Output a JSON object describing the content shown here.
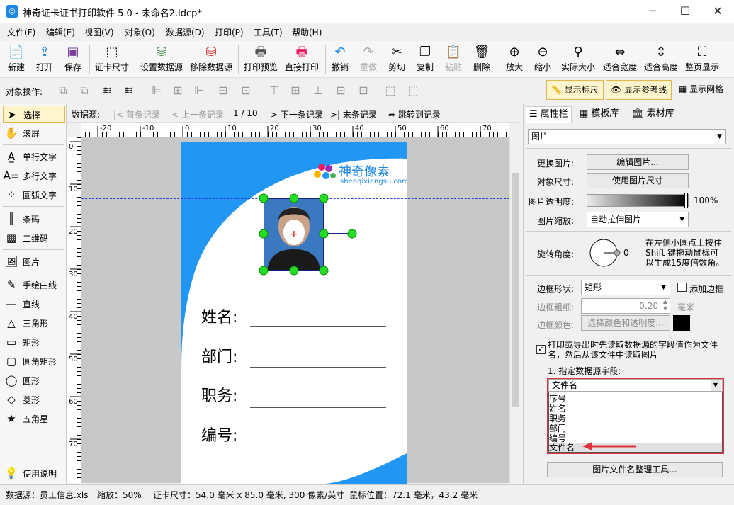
{
  "window": {
    "title": "神奇证卡证书打印软件 5.0 - 未命名2.idcp*",
    "min": "─",
    "max": "☐",
    "close": "✕"
  },
  "menu": [
    "文件(F)",
    "编辑(E)",
    "视图(V)",
    "对象(O)",
    "数据源(D)",
    "打印(P)",
    "工具(T)",
    "帮助(H)"
  ],
  "toolbar": [
    "新建",
    "打开",
    "保存",
    "证卡尺寸",
    "设置数据源",
    "移除数据源",
    "打印预览",
    "直接打印",
    "撤销",
    "重做",
    "剪切",
    "复制",
    "粘贴",
    "删除",
    "放大",
    "缩小",
    "实际大小",
    "适合宽度",
    "适合高度",
    "整页显示"
  ],
  "objbar": {
    "label": "对象操作:",
    "show_ruler": "显示标尺",
    "show_guides": "显示参考线",
    "show_grid": "显示网格"
  },
  "tools": [
    "选择",
    "滚屏",
    "单行文字",
    "多行文字",
    "圆弧文字",
    "条码",
    "二维码",
    "图片",
    "手绘曲线",
    "直线",
    "三角形",
    "矩形",
    "圆角矩形",
    "圆形",
    "菱形",
    "五角星",
    "使用说明"
  ],
  "nav": {
    "label": "数据源:",
    "first": "首条记录",
    "prev": "上一条记录",
    "pos": "1 / 10",
    "next": "下一条记录",
    "last": "末条记录",
    "jump": "跳转到记录"
  },
  "ruler": {
    "h_ticks": [
      "-20",
      "-10",
      "0",
      "10",
      "20",
      "30",
      "40",
      "50",
      "60",
      "70"
    ],
    "v_ticks": [
      "0",
      "10",
      "20",
      "30",
      "40",
      "50",
      "60",
      "70"
    ]
  },
  "card": {
    "brand_cn": "神奇像素",
    "brand_en": "shenqixiangsu.com",
    "fields": [
      "姓名:",
      "部门:",
      "职务:",
      "编号:"
    ]
  },
  "panel": {
    "tabs": [
      "属性栏",
      "模板库",
      "素材库"
    ],
    "object_type": "图片",
    "change_image_label": "更换图片:",
    "edit_image_btn": "编辑图片...",
    "obj_size_label": "对象尺寸:",
    "use_image_size_btn": "使用图片尺寸",
    "opacity_label": "图片透明度:",
    "opacity_value": "100%",
    "scale_label": "图片缩放:",
    "scale_value": "自动拉伸图片",
    "rotate_label": "旋转角度:",
    "rotate_value": "0",
    "rotate_hint": "在左侧小圆点上按住Shift 键拖动鼠标可以生成15度倍数角。",
    "border_shape_label": "边框形状:",
    "border_shape_value": "矩形",
    "add_border": "添加边框",
    "border_width_label": "边框粗细:",
    "border_width_value": "0.20",
    "border_width_unit": "毫米",
    "border_color_label": "边框颜色:",
    "border_color_btn": "选择颜色和透明度...",
    "read_field_text": "打印或导出时先读取数据源的字段值作为文件名，然后从该文件中读取图片",
    "field_label": "1. 指定数据源字段:",
    "field_value": "文件名",
    "field_options": [
      "序号",
      "姓名",
      "职务",
      "部门",
      "编号",
      "文件名"
    ],
    "organize_btn": "图片文件名整理工具..."
  },
  "status": {
    "datasource": "数据源：员工信息.xls",
    "zoom": "缩放：50%",
    "cardsize": "证卡尺寸：54.0 毫米 x 85.0 毫米, 300 像素/英寸",
    "mouse": "鼠标位置：72.1 毫米，43.2 毫米"
  }
}
